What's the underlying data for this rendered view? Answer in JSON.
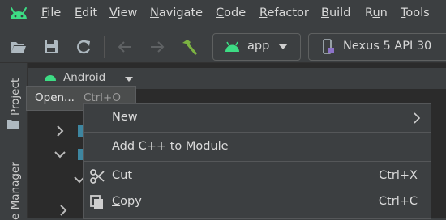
{
  "menubar": {
    "items": [
      {
        "pre": "",
        "u": "F",
        "post": "ile"
      },
      {
        "pre": "",
        "u": "E",
        "post": "dit"
      },
      {
        "pre": "",
        "u": "V",
        "post": "iew"
      },
      {
        "pre": "",
        "u": "N",
        "post": "avigate"
      },
      {
        "pre": "",
        "u": "C",
        "post": "ode"
      },
      {
        "pre": "",
        "u": "R",
        "post": "efactor"
      },
      {
        "pre": "",
        "u": "B",
        "post": "uild"
      },
      {
        "pre": "R",
        "u": "u",
        "post": "n"
      },
      {
        "pre": "",
        "u": "T",
        "post": "ools"
      }
    ]
  },
  "toolbar": {
    "app_config": "app",
    "device": "Nexus 5 API 30"
  },
  "side_tabs": {
    "project": "Project",
    "resource_manager": "e Manager"
  },
  "panel": {
    "view_mode": "Android"
  },
  "tooltip": {
    "action": "Open...",
    "shortcut": "Ctrl+O"
  },
  "context_menu": {
    "new": "New",
    "add_cpp": "Add C++ to Module",
    "cut": {
      "pre": "Cu",
      "u": "t",
      "post": "",
      "shortcut": "Ctrl+X"
    },
    "copy": {
      "pre": "",
      "u": "C",
      "post": "opy",
      "shortcut": "Ctrl+C"
    }
  },
  "colors": {
    "android_green": "#3ddc84",
    "build_hammer": "#7cb342",
    "background": "#3c3f41",
    "panel": "#2b2b2b"
  }
}
